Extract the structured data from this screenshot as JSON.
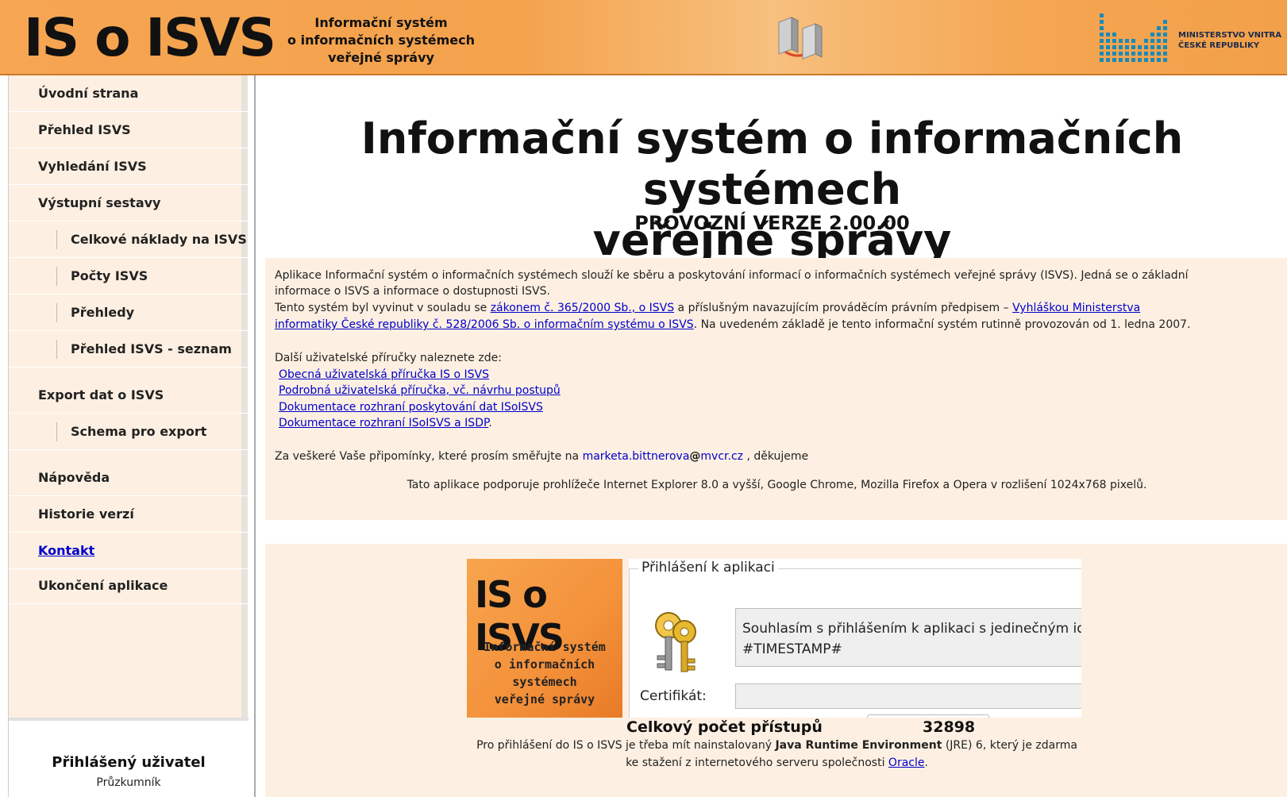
{
  "header": {
    "logo": "IS o ISVS",
    "subtitle_lines": [
      "Informační systém",
      "o informačních systémech",
      "veřejné správy"
    ],
    "ministry_lines": [
      "MINISTERSTVO VNITRA",
      "ČESKÉ REPUBLIKY"
    ]
  },
  "sidebar": {
    "items": [
      {
        "label": "Úvodní strana"
      },
      {
        "label": "Přehled ISVS"
      },
      {
        "label": "Vyhledání ISVS"
      },
      {
        "label": "Výstupní sestavy"
      },
      {
        "label": "Celkové náklady na ISVS"
      },
      {
        "label": "Počty ISVS"
      },
      {
        "label": "Přehledy"
      },
      {
        "label": "Přehled ISVS - seznam"
      },
      {
        "label": "Export dat o ISVS"
      },
      {
        "label": "Schema pro export"
      },
      {
        "label": "Nápověda"
      },
      {
        "label": "Historie verzí"
      },
      {
        "label": "Kontakt"
      },
      {
        "label": "Ukončení aplikace"
      }
    ],
    "user_title": "Přihlášený uživatel",
    "user_name": "Průzkumník"
  },
  "main": {
    "title_line1": "Informační systém o informačních systémech",
    "title_line2": "veřejné správy",
    "version": "PROVOZNÍ VERZE 2.00.00",
    "info": {
      "p1_line1": "Aplikace Informační systém o informačních systémech slouží ke sběru a poskytování informací o informačních systémech veřejné správy (ISVS). Jedná se o základní",
      "p1_line2": "informace o ISVS a informace o dostupnosti ISVS.",
      "p2_a": " Tento systém byl vyvinut v souladu se ",
      "p2_link1": "zákonem č. 365/2000 Sb., o ISVS",
      "p2_b": " a příslušným navazujícím prováděcím právním předpisem – ",
      "p2_link2a": "Vyhláškou Ministerstva",
      "p2_link2b": "informatiky České republiky č. 528/2006 Sb. o informačním systému o ISVS",
      "p2_c": ". Na uvedeném základě je tento informační systém rutinně provozován od 1. ledna 2007.",
      "guides_intro": "Další uživatelské příručky naleznete zde:",
      "guide1": "Obecná uživatelská příručka IS o ISVS",
      "guide2": "Podrobná uživatelská příručka, vč. návrhu postupů",
      "guide3": "Dokumentace rozhraní poskytování dat ISoISVS",
      "guide4": "Dokumentace rozhraní ISoISVS a ISDP",
      "guide4_tail": ".",
      "feedback_a": "Za veškeré Vaše připomínky, které prosím směřujte na ",
      "feedback_email_user": "marketa.bittnerova",
      "feedback_email_domain": "mvcr.cz",
      "feedback_b": " , děkujeme",
      "browsers": "Tato aplikace podporuje prohlížeče Internet Explorer 8.0 a vyšší, Google Chrome, Mozilla Firefox a Opera v rozlišení 1024x768 pixelů."
    },
    "login": {
      "logo_big": "IS o ISVS",
      "logo_small_lines": [
        "Informační systém",
        "o informačních",
        "systémech",
        "veřejné správy"
      ],
      "legend": "Přihlášení k aplikaci",
      "consent_line1": "Souhlasím s přihlášením k aplikaci s jedinečným identifikátorem",
      "consent_line2": "#TIMESTAMP#",
      "cert_label": "Certifikát:",
      "access_label": "Celkový počet přístupů",
      "access_count": "32898",
      "jre_a": "Pro přihlášení do IS o ISVS je třeba mít nainstalovaný ",
      "jre_bold": "Java Runtime Environment",
      "jre_b": " (JRE) 6, který je zdarma",
      "jre2_a": "ke stažení z internetového serveru společnosti ",
      "jre2_link": "Oracle",
      "jre2_b": "."
    }
  }
}
